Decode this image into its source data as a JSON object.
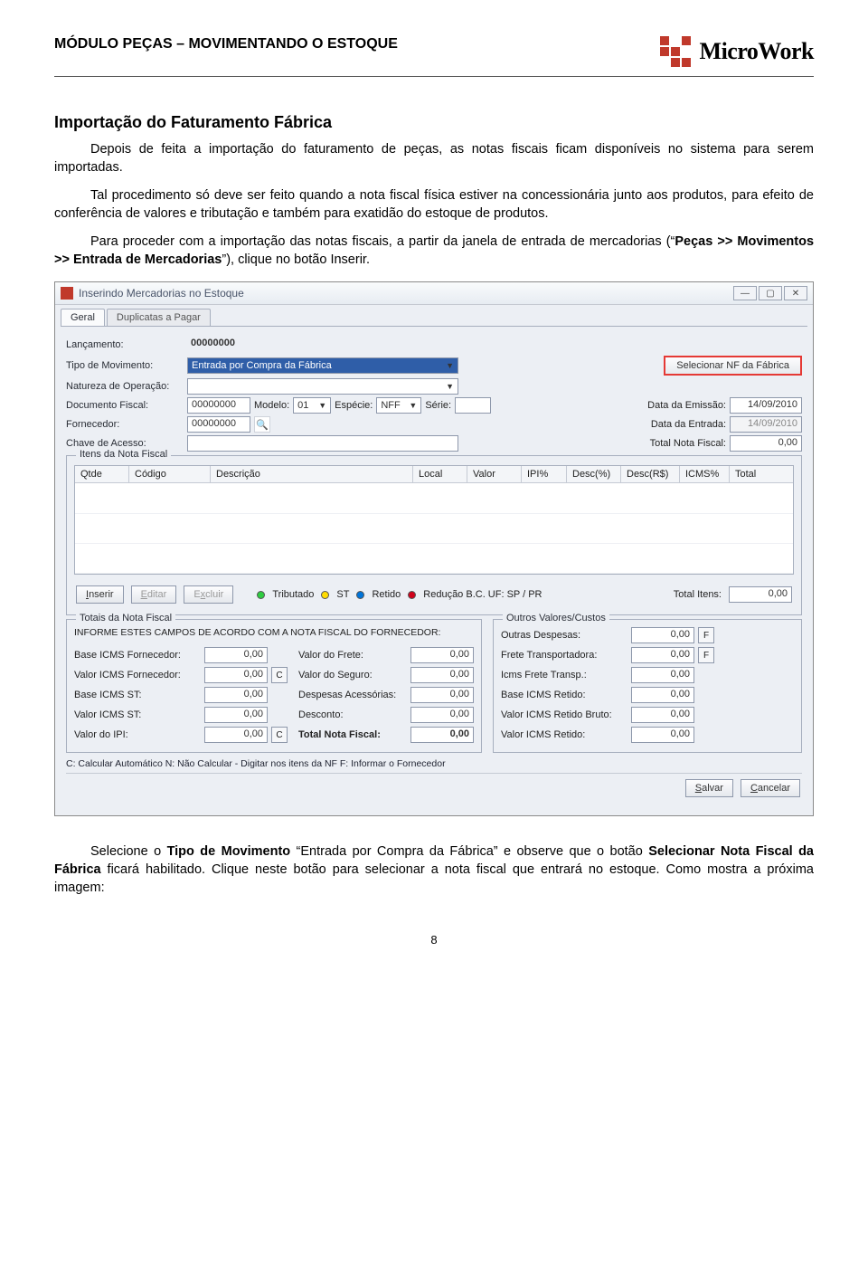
{
  "header": {
    "module_title": "MÓDULO PEÇAS – MOVIMENTANDO O ESTOQUE",
    "brand": "MicroWork"
  },
  "content": {
    "section_title": "Importação do Faturamento Fábrica",
    "p1": "Depois de feita a importação do faturamento de peças, as notas fiscais ficam disponíveis no sistema para serem importadas.",
    "p2": "Tal procedimento só deve ser feito quando a nota fiscal física estiver na concessionária junto aos produtos, para efeito de conferência de valores e tributação e também para exatidão do estoque de produtos.",
    "p3_a": "Para proceder com a importação das notas fiscais, a partir da janela de entrada de mercadorias (“",
    "p3_b": "Peças >> Movimentos >> Entrada de Mercadorias",
    "p3_c": "”), clique no botão Inserir."
  },
  "window": {
    "title": "Inserindo Mercadorias no Estoque",
    "winbtns": {
      "min": "—",
      "max": "▢",
      "close": "✕"
    },
    "tabs": {
      "geral": "Geral",
      "dup": "Duplicatas a Pagar"
    },
    "form": {
      "lancamento_lbl": "Lançamento:",
      "lancamento_val": "00000000",
      "tipo_mov_lbl": "Tipo de Movimento:",
      "tipo_mov_val": "Entrada por Compra da Fábrica",
      "sel_nf_btn": "Selecionar NF da Fábrica",
      "nat_op_lbl": "Natureza de Operação:",
      "doc_fiscal_lbl": "Documento Fiscal:",
      "doc_fiscal_val": "00000000",
      "modelo_lbl": "Modelo:",
      "modelo_val": "01",
      "especie_lbl": "Espécie:",
      "especie_val": "NFF",
      "serie_lbl": "Série:",
      "data_emissao_lbl": "Data da Emissão:",
      "data_emissao_val": "14/09/2010",
      "fornecedor_lbl": "Fornecedor:",
      "fornecedor_val": "00000000",
      "data_entrada_lbl": "Data da Entrada:",
      "data_entrada_val": "14/09/2010",
      "chave_lbl": "Chave de Acesso:",
      "total_nota_lbl": "Total Nota Fiscal:",
      "total_nota_val": "0,00",
      "itens_title": "Itens da Nota Fiscal"
    },
    "thead": {
      "qtde": "Qtde",
      "codigo": "Código",
      "descricao": "Descrição",
      "local": "Local",
      "valor": "Valor",
      "ipi": "IPI%",
      "descp": "Desc(%)",
      "descr": "Desc(R$)",
      "icms": "ICMS%",
      "total": "Total"
    },
    "legend": {
      "inserir": "Inserir",
      "editar": "Editar",
      "excluir": "Excluir",
      "trib": "Tributado",
      "st": "ST",
      "retido": "Retido",
      "reduc": "Redução B.C. UF: SP / PR",
      "total_itens_lbl": "Total Itens:",
      "total_itens_val": "0,00"
    },
    "totals": {
      "title_l": "Totais da Nota Fiscal",
      "instr": "INFORME ESTES CAMPOS DE ACORDO COM A NOTA FISCAL DO FORNECEDOR:",
      "base_icms_forn": "Base ICMS Fornecedor:",
      "valor_icms_forn": "Valor ICMS Fornecedor:",
      "base_icms_st": "Base ICMS ST:",
      "valor_icms_st": "Valor ICMS ST:",
      "valor_ipi": "Valor do IPI:",
      "valor_frete": "Valor do Frete:",
      "valor_seguro": "Valor do Seguro:",
      "desp_acess": "Despesas Acessórias:",
      "desconto": "Desconto:",
      "total_nota": "Total Nota Fiscal:",
      "title_r": "Outros Valores/Custos",
      "outras_desp": "Outras Despesas:",
      "frete_transp": "Frete Transportadora:",
      "icms_frete": "Icms Frete Transp.:",
      "base_icms_retido": "Base ICMS Retido:",
      "valor_icms_retido_bruto": "Valor ICMS Retido Bruto:",
      "valor_icms_retido": "Valor ICMS Retido:",
      "zero": "0,00",
      "zero_b": "0,00",
      "sq_c": "C",
      "sq_f": "F"
    },
    "botline": "C: Calcular Automático     N: Não Calcular - Digitar nos itens da NF     F: Informar o Fornecedor",
    "bottom": {
      "salvar": "Salvar",
      "cancelar": "Cancelar"
    }
  },
  "footer_text": {
    "a": "Selecione o ",
    "b": "Tipo de Movimento",
    "c": " “Entrada por Compra da Fábrica” e observe que o botão ",
    "d": "Selecionar Nota Fiscal da Fábrica",
    "e": " ficará habilitado. Clique neste botão para selecionar a nota fiscal que entrará no estoque. Como mostra a próxima imagem:"
  },
  "page_number": "8"
}
